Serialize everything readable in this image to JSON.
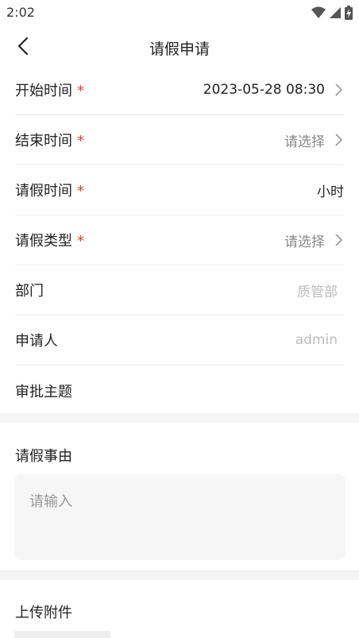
{
  "status": {
    "time": "2:02",
    "icons": [
      "wifi-icon",
      "signal-icon",
      "battery-charging-icon"
    ]
  },
  "header": {
    "title": "请假申请",
    "back_icon": "chevron-left-icon"
  },
  "form": {
    "start_time": {
      "label": "开始时间",
      "required_mark": "*",
      "value": "2023-05-28 08:30"
    },
    "end_time": {
      "label": "结束时间",
      "required_mark": "*",
      "value": "请选择"
    },
    "duration": {
      "label": "请假时间",
      "required_mark": "*",
      "value": "小时"
    },
    "leave_type": {
      "label": "请假类型",
      "required_mark": "*",
      "value": "请选择"
    },
    "department": {
      "label": "部门",
      "value": "质管部"
    },
    "applicant": {
      "label": "申请人",
      "value": "admin"
    },
    "subject": {
      "label": "审批主题",
      "value": ""
    }
  },
  "reason": {
    "title": "请假事由",
    "placeholder": "请输入"
  },
  "attachment": {
    "title": "上传附件"
  },
  "colors": {
    "required": "#e23d3d",
    "section_gap": "#f4f4f4",
    "input_bg": "#f6f6f6"
  }
}
